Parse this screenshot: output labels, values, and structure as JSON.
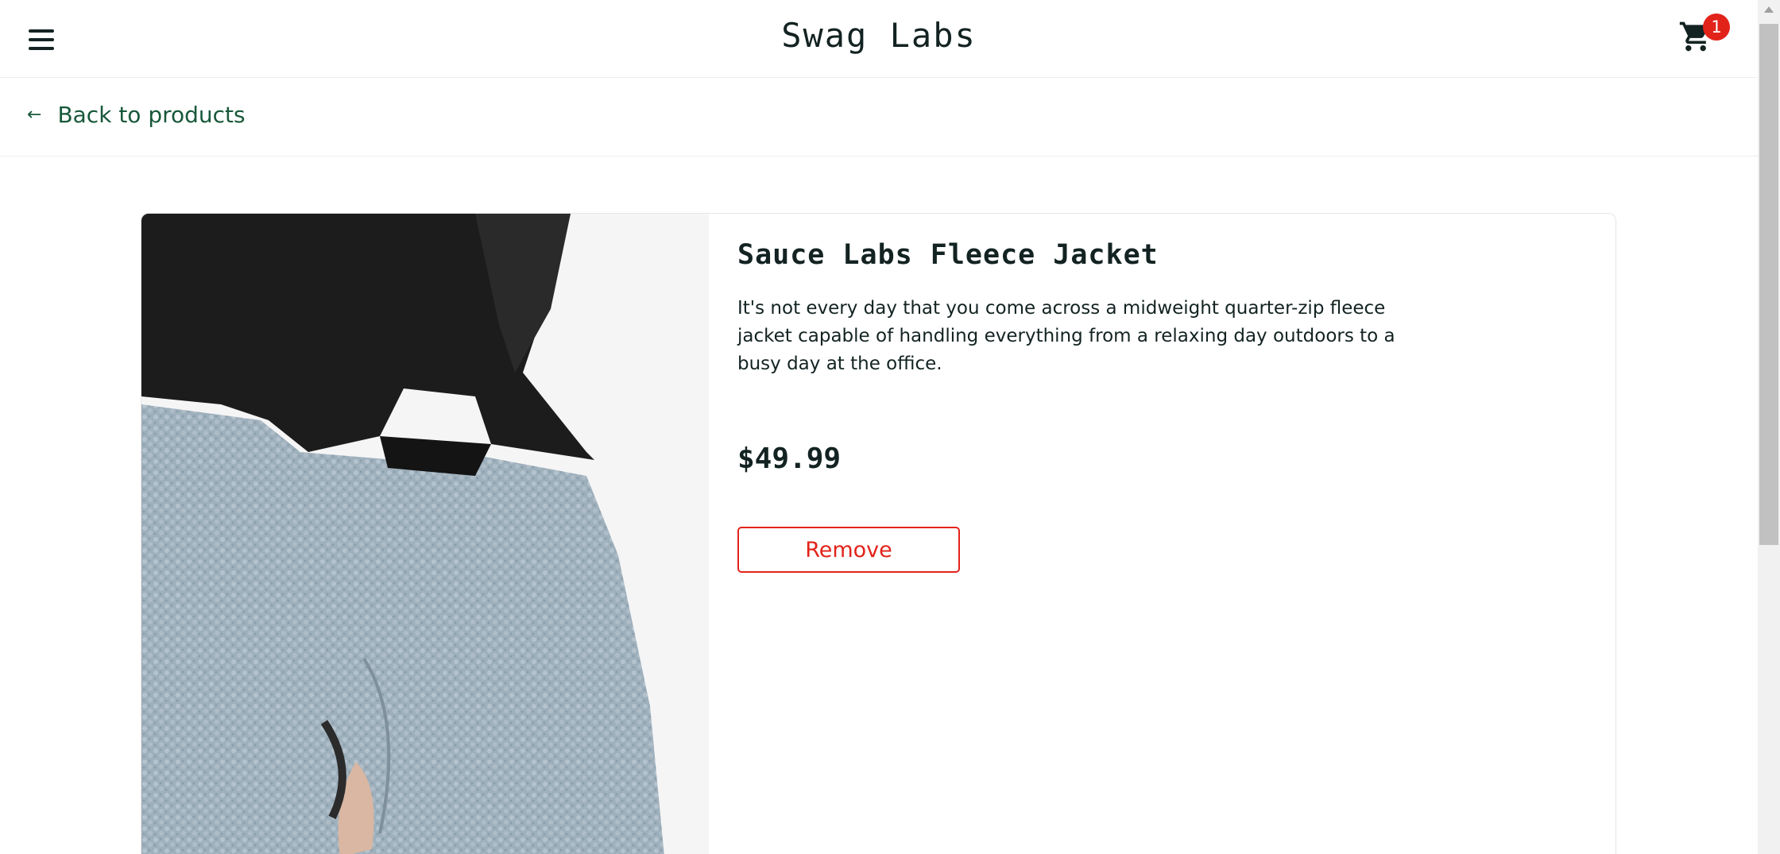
{
  "header": {
    "app_title": "Swag Labs",
    "cart_count": "1",
    "menu_icon": "hamburger-menu-icon",
    "cart_icon": "shopping-cart-icon"
  },
  "nav": {
    "back_label": "Back to products",
    "back_icon": "arrow-left-icon"
  },
  "product": {
    "name": "Sauce Labs Fleece Jacket",
    "description": "It's not every day that you come across a midweight quarter-zip fleece jacket capable of handling everything from a relaxing day outdoors to a busy day at the office.",
    "price": "$49.99",
    "action_label": "Remove"
  },
  "colors": {
    "accent_green": "#18583a",
    "danger_red": "#e2231a",
    "text_dark": "#132322"
  }
}
